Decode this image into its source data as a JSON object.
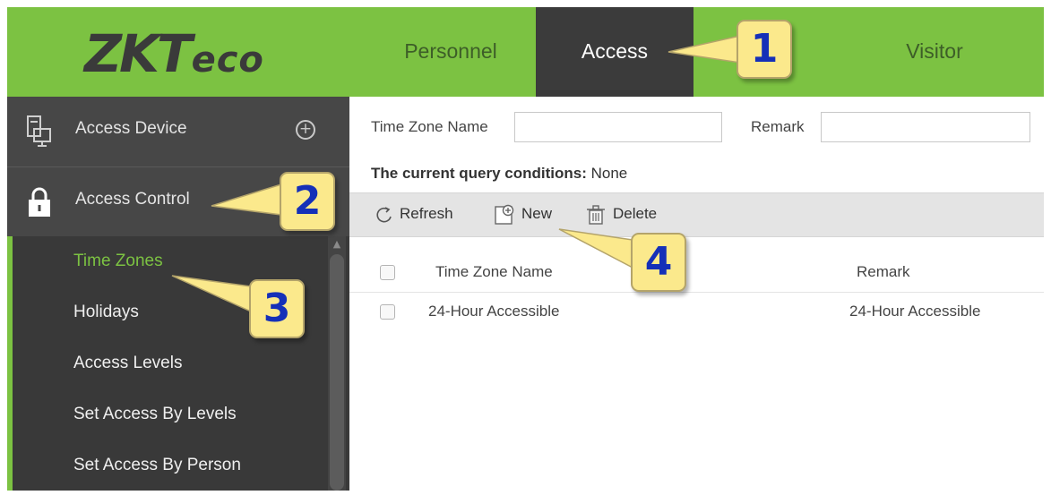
{
  "brand": {
    "logo_main": "ZKT",
    "logo_eco": "eco"
  },
  "nav": {
    "personnel": "Personnel",
    "access": "Access",
    "visitor": "Visitor"
  },
  "sidebar": {
    "access_device": "Access Device",
    "access_control": "Access Control",
    "items": [
      {
        "label": "Time Zones"
      },
      {
        "label": "Holidays"
      },
      {
        "label": "Access Levels"
      },
      {
        "label": "Set Access By Levels"
      },
      {
        "label": "Set Access By Person"
      }
    ]
  },
  "search": {
    "time_zone_name_label": "Time Zone Name",
    "time_zone_name_value": "",
    "remark_label": "Remark",
    "remark_value": ""
  },
  "query": {
    "label": "The current query conditions:",
    "value": "None"
  },
  "toolbar": {
    "refresh": "Refresh",
    "new": "New",
    "delete": "Delete"
  },
  "table": {
    "columns": [
      "Time Zone Name",
      "Remark"
    ],
    "rows": [
      {
        "name": "24-Hour Accessible",
        "remark": "24-Hour Accessible"
      }
    ]
  },
  "callouts": [
    "1",
    "2",
    "3",
    "4"
  ],
  "colors": {
    "brand_green": "#7cc242",
    "active_tab": "#3b3b3b",
    "sidebar": "#3c3c3c",
    "callout_fill": "#fbe98c",
    "callout_text": "#1530b8"
  }
}
